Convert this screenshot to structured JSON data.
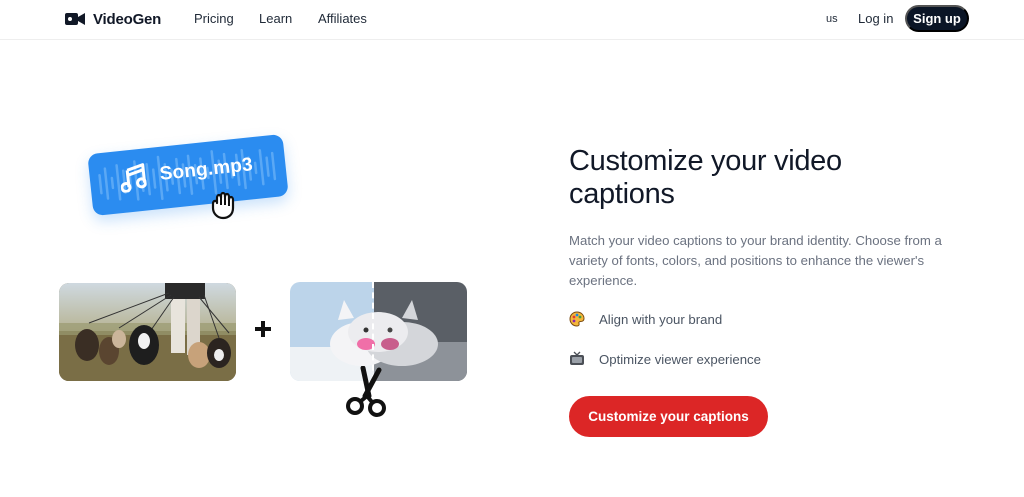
{
  "nav": {
    "brand": "VideoGen",
    "links": [
      "Pricing",
      "Learn",
      "Affiliates"
    ],
    "language": "us",
    "login": "Log in",
    "signup": "Sign up"
  },
  "hero": {
    "song_label": "Song.mp3",
    "headline": "Customize your video captions",
    "description": "Match your video captions to your brand identity. Choose from a variety of fonts, colors, and positions to enhance the viewer's experience.",
    "features": [
      {
        "icon": "palette-icon",
        "label": "Align with your brand"
      },
      {
        "icon": "tv-icon",
        "label": "Optimize viewer experience"
      }
    ],
    "cta": "Customize your captions"
  },
  "colors": {
    "accent_red": "#dc2626",
    "song_blue": "#2b8cf0",
    "dark_button": "#0b1526"
  }
}
